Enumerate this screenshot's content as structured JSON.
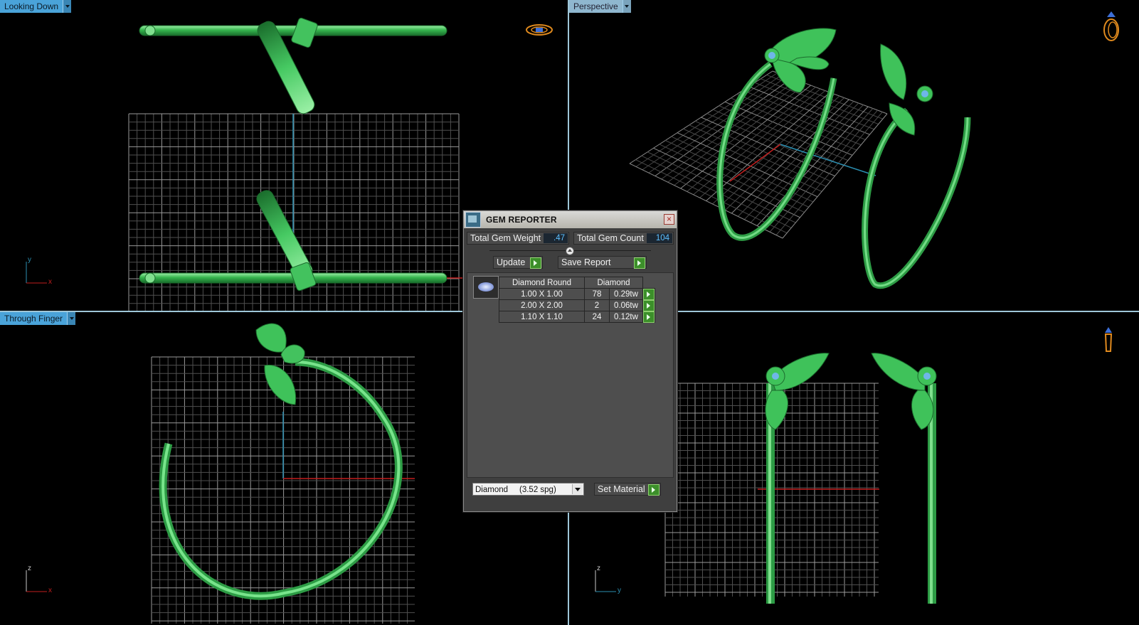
{
  "viewports": {
    "top_left": {
      "label": "Looking Down"
    },
    "top_right": {
      "label": "Perspective"
    },
    "bottom_left": {
      "label": "Through Finger"
    },
    "bottom_right": {
      "label": ""
    }
  },
  "axes": {
    "top_left": {
      "up": "y",
      "right": "x"
    },
    "bottom_left": {
      "up": "z",
      "right": "x"
    },
    "bottom_right": {
      "up": "z",
      "right": "y"
    }
  },
  "view_icons": [
    "ring-flat-icon",
    "ring-perspective-icon",
    "ring-side-icon"
  ],
  "gem_reporter": {
    "title": "GEM REPORTER",
    "total_weight_label": "Total Gem Weight",
    "total_weight_value": ".47",
    "total_count_label": "Total Gem Count",
    "total_count_value": "104",
    "update_label": "Update",
    "save_report_label": "Save Report",
    "table": {
      "col_shape": "Diamond Round",
      "col_material": "Diamond",
      "rows": [
        {
          "size": "1.00 X 1.00",
          "count": "78",
          "weight": "0.29tw"
        },
        {
          "size": "2.00 X 2.00",
          "count": "2",
          "weight": "0.06tw"
        },
        {
          "size": "1.10 X 1.10",
          "count": "24",
          "weight": "0.12tw"
        }
      ]
    },
    "material_select": "Diamond     (3.52 spg)",
    "set_material_label": "Set Material"
  },
  "colors": {
    "metal": "#3fc25a",
    "gem": "#6fb6e8",
    "grid": "#7a7a7a",
    "axis_red": "#c21e1e",
    "axis_blue": "#2b8fb2",
    "label_bg": "#4aa3d9"
  }
}
